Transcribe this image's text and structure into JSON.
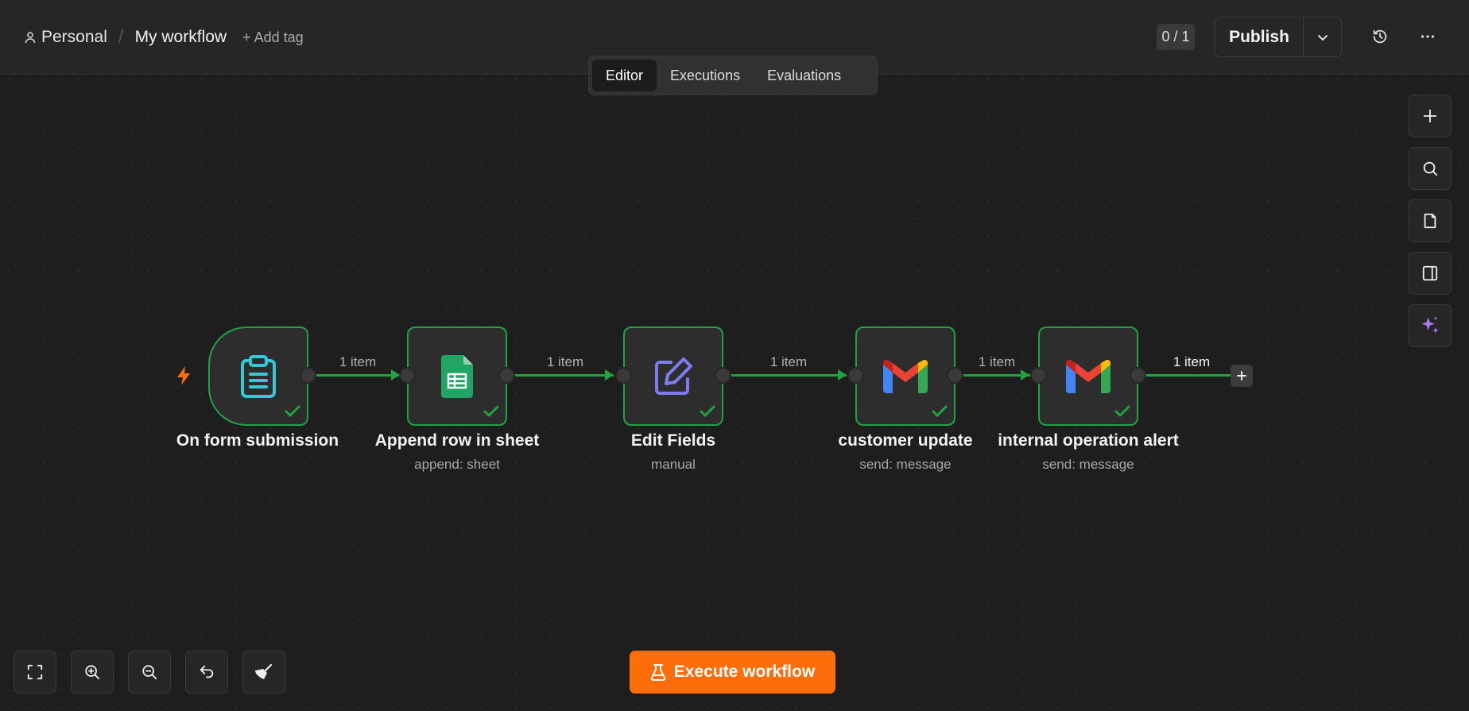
{
  "header": {
    "project": "Personal",
    "separator": "/",
    "workflow_name": "My workflow",
    "add_tag": "+ Add tag",
    "count_badge": "0 / 1",
    "publish_label": "Publish"
  },
  "tabs": [
    {
      "label": "Editor",
      "active": true
    },
    {
      "label": "Executions",
      "active": false
    },
    {
      "label": "Evaluations",
      "active": false
    }
  ],
  "nodes": [
    {
      "title": "On form submission",
      "subtitle": "",
      "icon": "clipboard-icon",
      "status": "success"
    },
    {
      "title": "Append row in sheet",
      "subtitle": "append: sheet",
      "icon": "google-sheets-icon",
      "status": "success"
    },
    {
      "title": "Edit Fields",
      "subtitle": "manual",
      "icon": "edit-pencil-icon",
      "status": "success"
    },
    {
      "title": "customer update",
      "subtitle": "send: message",
      "icon": "gmail-icon",
      "status": "success"
    },
    {
      "title": "internal operation alert",
      "subtitle": "send: message",
      "icon": "gmail-icon",
      "status": "success"
    }
  ],
  "edges": [
    {
      "label": "1 item"
    },
    {
      "label": "1 item"
    },
    {
      "label": "1 item"
    },
    {
      "label": "1 item"
    },
    {
      "label": "1 item"
    }
  ],
  "execute_button": "Execute workflow",
  "colors": {
    "accent": "#ff6d0a",
    "success": "#22a341",
    "canvas": "#1e1e1e",
    "panel": "#262626"
  }
}
